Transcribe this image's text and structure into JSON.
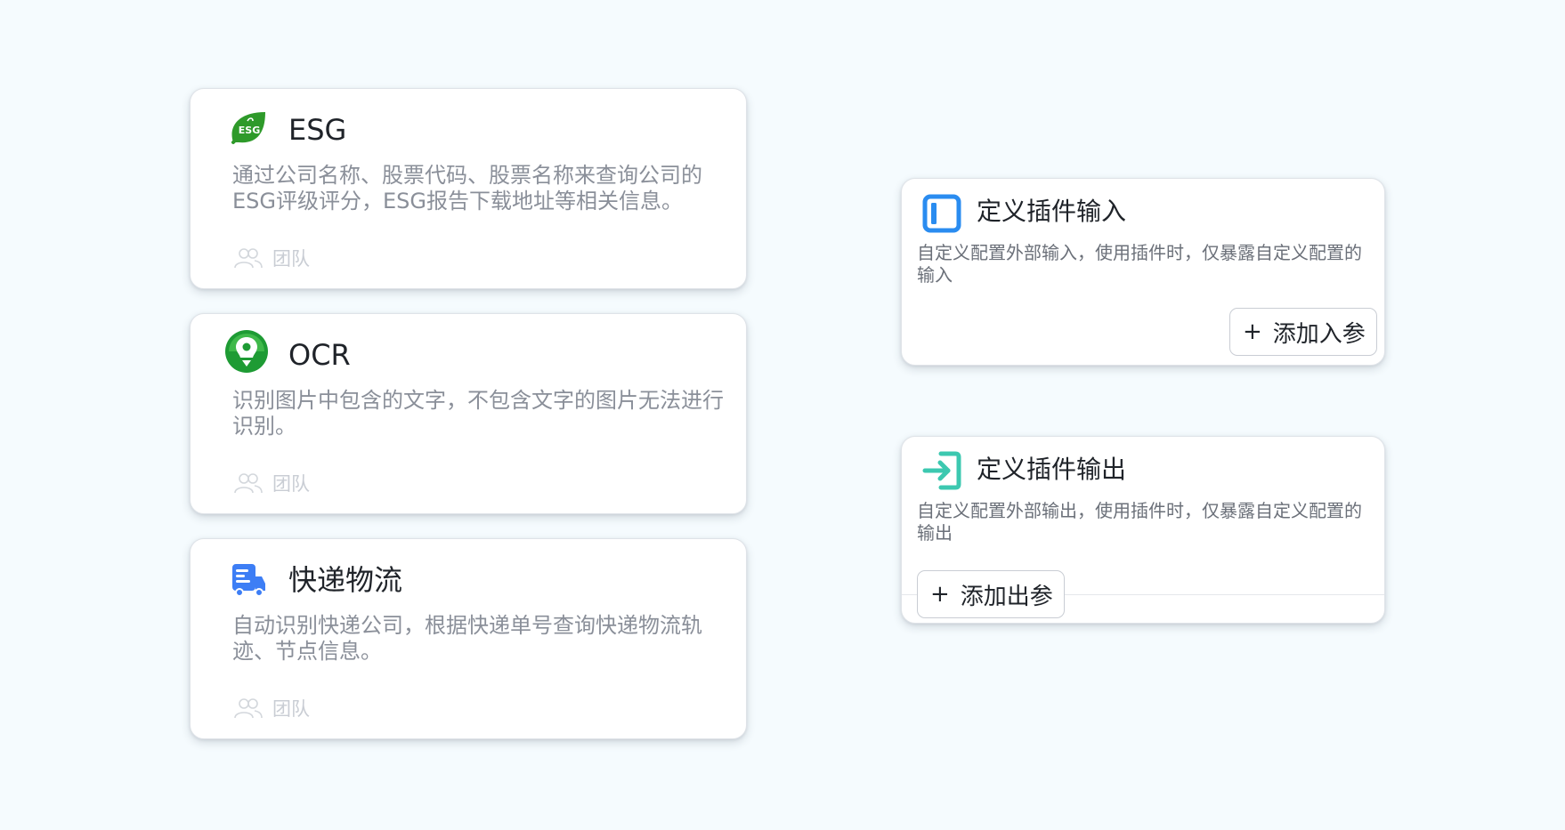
{
  "plugins": [
    {
      "title": "ESG",
      "description": "通过公司名称、股票代码、股票名称来查询公司的ESG评级评分，ESG报告下载地址等相关信息。",
      "team_label": "团队",
      "icon": "esg-leaf-icon"
    },
    {
      "title": "OCR",
      "description": "识别图片中包含的文字，不包含文字的图片无法进行识别。",
      "team_label": "团队",
      "icon": "ocr-lightbulb-icon"
    },
    {
      "title": "快递物流",
      "description": "自动识别快递公司，根据快递单号查询快递物流轨迹、节点信息。",
      "team_label": "团队",
      "icon": "delivery-truck-icon"
    }
  ],
  "define_input": {
    "title": "定义插件输入",
    "description": "自定义配置外部输入，使用插件时，仅暴露自定义配置的输入",
    "button_label": "添加入参",
    "button_symbol": "+",
    "icon": "input-panel-icon",
    "icon_color": "#2a8cf0"
  },
  "define_output": {
    "title": "定义插件输出",
    "description": "自定义配置外部输出，使用插件时，仅暴露自定义配置的输出",
    "button_label": "添加出参",
    "button_symbol": "+",
    "icon": "output-arrow-icon",
    "icon_color": "#3cc8b0"
  },
  "colors": {
    "background": "#f5fbfe",
    "esg_green": "#2e9a2a",
    "ocr_green": "#1e9b34",
    "delivery_blue": "#3d7ef5"
  }
}
